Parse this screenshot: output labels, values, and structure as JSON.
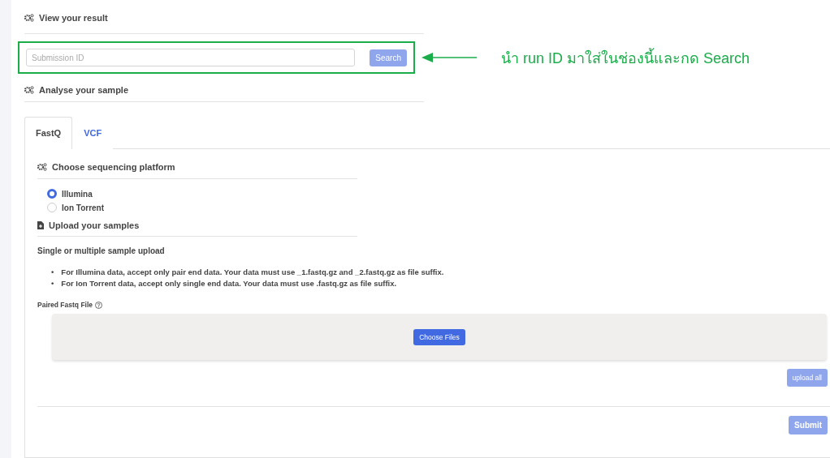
{
  "result_section": {
    "title": "View your result",
    "search": {
      "placeholder": "Submission ID",
      "button": {
        "label": "Search",
        "disabled": true
      }
    }
  },
  "annotation": {
    "note": "นำ run ID มาใส่ในช่องนี้และกด Search"
  },
  "analyse_section": {
    "title": "Analyse your sample"
  },
  "tabs": [
    {
      "label": "FastQ",
      "selected": true
    },
    {
      "label": "VCF",
      "selected": false
    }
  ],
  "platform": {
    "title": "Choose sequencing platform",
    "options": [
      {
        "label": "Illumina",
        "selected": true
      },
      {
        "label": "Ion Torrent",
        "selected": false
      }
    ]
  },
  "upload": {
    "title": "Upload your samples",
    "subtitle": "Single or multiple sample upload",
    "notes": [
      {
        "bullet": "•",
        "text": "For Illumina data, accept only pair end data. Your data must use _1.fastq.gz and _2.fastq.gz as file suffix."
      },
      {
        "bullet": "•",
        "text": "For Ion Torrent data, accept only single end data. Your data must use .fastq.gz as file suffix."
      }
    ],
    "field_label": "Paired Fastq File",
    "choose_button": {
      "label": "Choose Files",
      "disabled": false
    },
    "upload_all_button": {
      "label": "upload all",
      "disabled": true
    }
  },
  "submit_button": {
    "label": "Submit",
    "disabled": true
  }
}
